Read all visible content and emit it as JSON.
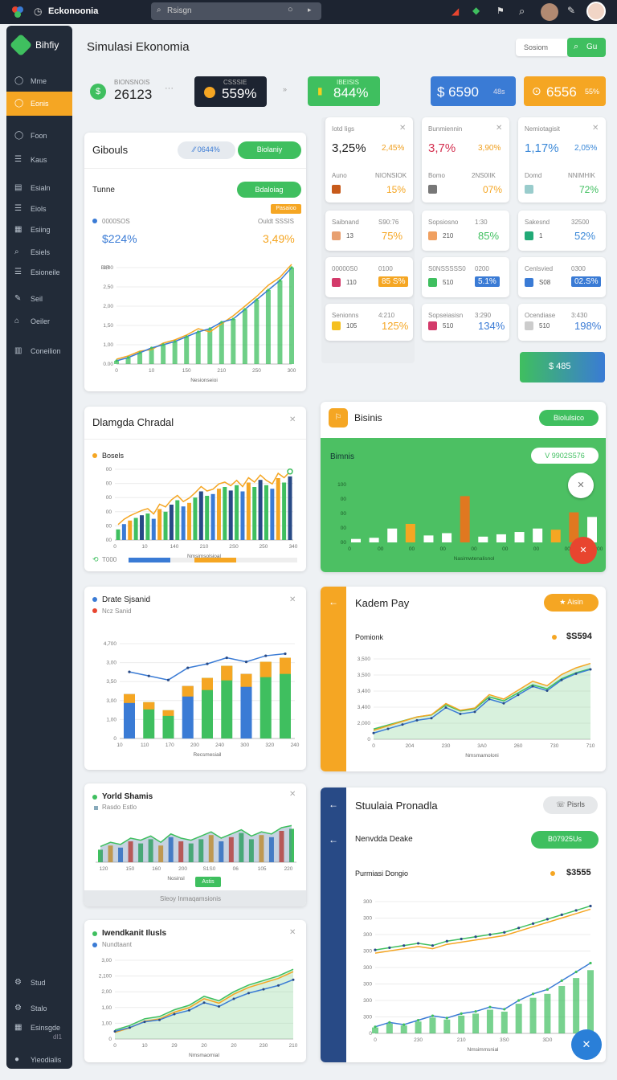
{
  "topbar": {
    "app_name": "Eckonoonia",
    "search_placeholder": "Rsisgn"
  },
  "sidebar": {
    "brand": "Bihfiy",
    "items": [
      {
        "label": "Mme",
        "icon": "circle-icon"
      },
      {
        "label": "Eonis",
        "icon": "circle-icon",
        "active": true
      },
      {
        "label": "Foon",
        "icon": "circle-icon"
      },
      {
        "label": "Kaus",
        "icon": "list-icon"
      },
      {
        "label": "Esialn",
        "icon": "doc-icon"
      },
      {
        "label": "Eiols",
        "icon": "list-icon"
      },
      {
        "label": "Esiing",
        "icon": "grid-icon"
      },
      {
        "label": "Esiels",
        "icon": "search-icon"
      },
      {
        "label": "Esioneile",
        "icon": "list-icon"
      },
      {
        "label": "Seil",
        "icon": "pen-icon"
      },
      {
        "label": "Oeiler",
        "icon": "lock-icon"
      },
      {
        "label": "Coneilion",
        "icon": "table-icon"
      }
    ],
    "bottom": [
      {
        "label": "Stud",
        "icon": "gear-icon"
      },
      {
        "label": "Stalo",
        "icon": "gear-icon"
      },
      {
        "label": "Esinsgde",
        "icon": "grid-icon",
        "sub": "dI1"
      },
      {
        "label": "Yieodialis",
        "icon": "avatar-icon"
      }
    ]
  },
  "header": {
    "title": "Simulasi Ekonomia",
    "search_label": "Sosiom",
    "go_label": "Gu"
  },
  "stats": [
    {
      "label": "BIONSNOIS",
      "value": "26123"
    },
    {
      "label": "CSSSIE",
      "value": "559%"
    },
    {
      "label": "IBEISIS",
      "value": "844%"
    },
    {
      "value": "$ 6590",
      "suffix": "48s"
    },
    {
      "value": "6556",
      "suffix": "55%"
    }
  ],
  "g1": {
    "title": "Gibouls",
    "pill1": "⁄⁄ 0644%",
    "pill2": "Biolaniy",
    "section": "Tunne",
    "btn": "Bdaloiag",
    "tag": "Pasaioo",
    "leg_label": "0000SOS",
    "leg_value": "$224%",
    "right_label": "Ouldt SSSIS",
    "right_value": "3,49%",
    "xlabel": "Nesionseioi",
    "yticks": [
      "3,00",
      "2,50",
      "2,00",
      "1,50",
      "1,00",
      "0.00"
    ],
    "xticks": [
      "0",
      "10",
      "150",
      "210",
      "250",
      "300"
    ],
    "ytitle": "BIR"
  },
  "chart_data": [
    {
      "type": "area",
      "title": "Gibouls",
      "x": [
        0,
        20,
        40,
        60,
        80,
        100,
        120,
        140,
        160,
        180,
        200,
        220,
        240,
        260,
        280,
        300
      ],
      "series": [
        {
          "name": "0000SOS",
          "values": [
            0.1,
            0.2,
            0.35,
            0.5,
            0.6,
            0.7,
            0.85,
            1.0,
            1.1,
            1.3,
            1.4,
            1.7,
            2.0,
            2.3,
            2.6,
            3.0
          ]
        },
        {
          "name": "Ouldt SSSIS",
          "values": [
            0.15,
            0.25,
            0.4,
            0.45,
            0.65,
            0.75,
            0.9,
            1.1,
            1.0,
            1.25,
            1.5,
            1.8,
            2.1,
            2.45,
            2.7,
            3.1
          ]
        }
      ],
      "ylim": [
        0,
        3.0
      ]
    },
    {
      "type": "bar",
      "title": "Dlamgda Chradal",
      "categories": [
        "1",
        "2",
        "3",
        "4",
        "5",
        "6",
        "7",
        "8",
        "9",
        "10",
        "11",
        "12",
        "13",
        "14",
        "15",
        "16",
        "17",
        "18",
        "19",
        "20",
        "21",
        "22",
        "23",
        "24",
        "25",
        "26",
        "27",
        "28",
        "29",
        "30"
      ],
      "series": [
        {
          "name": "Bosels",
          "values": [
            12,
            18,
            22,
            25,
            28,
            30,
            24,
            35,
            32,
            40,
            45,
            38,
            42,
            48,
            55,
            50,
            52,
            58,
            60,
            56,
            62,
            55,
            65,
            60,
            68,
            62,
            58,
            70,
            65,
            72
          ]
        }
      ],
      "ylim": [
        0,
        80
      ]
    },
    {
      "type": "bar",
      "title": "Bisinis",
      "categories": [
        "1",
        "2",
        "3",
        "4",
        "5",
        "6",
        "7",
        "8",
        "9",
        "10",
        "11",
        "12",
        "13",
        "14"
      ],
      "values": [
        3,
        4,
        12,
        16,
        6,
        8,
        40,
        5,
        7,
        9,
        12,
        11,
        26,
        22
      ],
      "ylim": [
        0,
        50
      ]
    },
    {
      "type": "bar",
      "title": "Drate Sjsanid",
      "categories": [
        "10",
        "110",
        "170",
        "200",
        "240",
        "300",
        "320",
        "340",
        "350"
      ],
      "series": [
        {
          "name": "Drate Sjsanid",
          "values": [
            2.2,
            1.8,
            1.4,
            2.6,
            3.0,
            3.6,
            3.2,
            3.8,
            4.0
          ]
        }
      ],
      "ylim": [
        0,
        4.7
      ]
    },
    {
      "type": "line",
      "title": "Kadem Pay",
      "x": [
        0,
        30,
        60,
        90,
        120,
        150,
        180,
        210,
        240,
        270,
        300,
        330,
        360,
        390,
        420,
        450
      ],
      "series": [
        {
          "name": "Pomionk",
          "values": [
            0.4,
            0.6,
            0.8,
            1.0,
            1.1,
            1.6,
            1.3,
            1.4,
            2.0,
            1.8,
            2.2,
            2.6,
            2.4,
            2.9,
            3.2,
            3.4
          ]
        }
      ],
      "ylim": [
        0,
        3.6
      ]
    },
    {
      "type": "bar",
      "title": "Yorld Shamis",
      "categories": [
        "1",
        "2",
        "3",
        "4",
        "5",
        "6",
        "7",
        "8",
        "9",
        "10",
        "11",
        "12",
        "13",
        "14",
        "15",
        "16",
        "17",
        "18",
        "19",
        "20"
      ],
      "values": [
        30,
        40,
        35,
        50,
        45,
        55,
        40,
        60,
        50,
        45,
        55,
        65,
        50,
        60,
        70,
        55,
        65,
        60,
        75,
        80
      ],
      "ylim": [
        0,
        100
      ]
    },
    {
      "type": "line",
      "title": "Stuulaia Pronadla",
      "x": [
        0,
        20,
        40,
        60,
        80,
        100,
        120,
        140,
        160,
        180,
        200,
        220,
        240,
        260,
        280,
        300
      ],
      "series": [
        {
          "name": "Nenvdda Deake",
          "values": [
            3.8,
            3.9,
            4.0,
            4.1,
            4.0,
            4.2,
            4.3,
            4.4,
            4.5,
            4.6,
            4.8,
            5.0,
            5.2,
            5.4,
            5.6,
            5.8
          ]
        },
        {
          "name": "Purmiasi Dongio",
          "values": [
            0.3,
            0.5,
            0.4,
            0.6,
            0.8,
            0.7,
            0.9,
            1.0,
            1.2,
            1.1,
            1.5,
            1.8,
            2.0,
            2.4,
            2.8,
            3.2
          ]
        }
      ],
      "ylim": [
        0,
        6
      ]
    },
    {
      "type": "line",
      "title": "Iwendkanit Ilusls",
      "x": [
        0,
        30,
        60,
        90,
        120,
        150,
        180,
        210,
        240,
        270,
        300,
        330,
        360
      ],
      "series": [
        {
          "name": "Nundtaant",
          "values": [
            0.4,
            0.6,
            0.9,
            1.0,
            1.3,
            1.5,
            1.9,
            1.7,
            2.1,
            2.4,
            2.6,
            2.8,
            3.1
          ]
        }
      ],
      "ylim": [
        0,
        3.5
      ]
    }
  ],
  "kpis": [
    {
      "label": "Iotd Iigs",
      "value": "3,25%",
      "pct": "2,45%",
      "sub": "Auno",
      "sub2": "NIONSIOK",
      "sub_v": "15%",
      "vcolor": "#222",
      "pcolor": "#f0a020"
    },
    {
      "label": "Bunmiennin",
      "value": "3,7%",
      "pct": "3,90%",
      "sub": "Bomo",
      "sub2": "2NS0IIK",
      "sub_v": "07%",
      "vcolor": "#d43050",
      "pcolor": "#f0a020"
    },
    {
      "label": "Nemiotagisit",
      "value": "1,17%",
      "pct": "2,05%",
      "sub": "Domd",
      "sub2": "NNIMHIK",
      "sub_v": "72%",
      "vcolor": "#3a88d8",
      "pcolor": "#3a88d8"
    },
    {
      "label": "Saibnand",
      "value": "75%",
      "sub2": "S90:76",
      "sub_v": "13"
    },
    {
      "label": "Sopsiosno",
      "value": "85%",
      "sub2": "1:30",
      "sub_v": "210"
    },
    {
      "label": "Sakesnd",
      "value": "52%",
      "sub2": "32500",
      "sub_v": "1"
    },
    {
      "label": "00000S0",
      "value": "85 S%",
      "sub2": "0100",
      "sub_v": "110"
    },
    {
      "label": "S0NSSSSS0",
      "value": "5.1%",
      "sub2": "0200",
      "sub_v": "510"
    },
    {
      "label": "Cenlsvied",
      "value": "02.S%",
      "sub2": "0300",
      "sub_v": "S08"
    },
    {
      "label": "Senionns",
      "value": "125%",
      "sub2": "4:210",
      "sub_v": "105"
    },
    {
      "label": "Sopseiasisn",
      "value": "134%",
      "sub2": "3:290",
      "sub_v": "510"
    },
    {
      "label": "Ocendiase",
      "value": "198%",
      "sub2": "3:430",
      "sub_v": "510"
    }
  ],
  "kpi_btn": "$ 485",
  "d1": {
    "title": "Dlamgda Chradal",
    "leg": "Bosels",
    "foot": "T000",
    "xlabel": "Nmsimsolsioal",
    "yticks": [
      "00",
      "00",
      "00",
      "00",
      "00",
      "00"
    ],
    "xticks": [
      "0",
      "10",
      "140",
      "210",
      "2S0",
      "250",
      "340"
    ]
  },
  "biz": {
    "title": "Bisinis",
    "btn": "Biolulsico",
    "sub": "Bimnis",
    "badge": "V 9902S576",
    "xlabel": "Nasimwtenalisnol",
    "yticks": [
      "100",
      "00",
      "00",
      "00",
      "00"
    ],
    "xticks": [
      "0",
      "00",
      "00",
      "00",
      "00",
      "00",
      "00",
      "00",
      "200"
    ]
  },
  "drate": {
    "title": "Drate Sjsanid",
    "sub": "Ncz Sanid",
    "xlabel": "Recsmesiail",
    "yticks": [
      "4,700",
      "3,00",
      "3,50",
      "3,00",
      "1,00",
      "0"
    ],
    "xticks": [
      "10",
      "110",
      "170",
      "200",
      "240",
      "300",
      "320",
      "240"
    ]
  },
  "kadem": {
    "title": "Kadem Pay",
    "btn": "Aisin",
    "label": "Pomionk",
    "value": "$S594",
    "xlabel": "Nmsmamoloni",
    "yticks": [
      "3,500",
      "3,500",
      "3,400",
      "3,400",
      "2,000",
      "0"
    ],
    "xticks": [
      "0",
      "204",
      "230",
      "3A0",
      "260",
      "730",
      "710"
    ]
  },
  "world": {
    "title": "Yorld Shamis",
    "sub": "Rasdo Estlo",
    "xticks": [
      "120",
      "150",
      "160",
      "200",
      "S1S0",
      "06",
      "105",
      "220"
    ],
    "badge": "Astis",
    "xlabel": "Nosinsl",
    "foot": "Sleoy Inmaqamsionis"
  },
  "stuu": {
    "title": "Stuulaia Pronadla",
    "btn": "Pisrls",
    "sub": "Nenvdda Deake",
    "badge": "B07925Us",
    "label2": "Purmiasi Dongio",
    "value2": "$3555",
    "xlabel": "Nmsimmsnial",
    "yticks": [
      "300",
      "300",
      "300",
      "300",
      "300",
      "300",
      "300",
      "300",
      "0"
    ],
    "xticks": [
      "0",
      "230",
      "210",
      "3S0",
      "3D0",
      "250"
    ]
  },
  "iwend": {
    "title": "Iwendkanit Ilusls",
    "sub": "Nundtaant",
    "xlabel": "Nmsmaomial",
    "yticks": [
      "3,00",
      "2,100",
      "2,00",
      "1,00",
      "1,00",
      "0"
    ],
    "xticks": [
      "0",
      "10",
      "29",
      "20",
      "20",
      "230",
      "210"
    ]
  },
  "colors": {
    "green": "#3fbf5f",
    "orange": "#f5a623",
    "blue": "#3a7bd5",
    "navy": "#284a86",
    "red": "#e8452f",
    "dark": "#1d2431"
  }
}
